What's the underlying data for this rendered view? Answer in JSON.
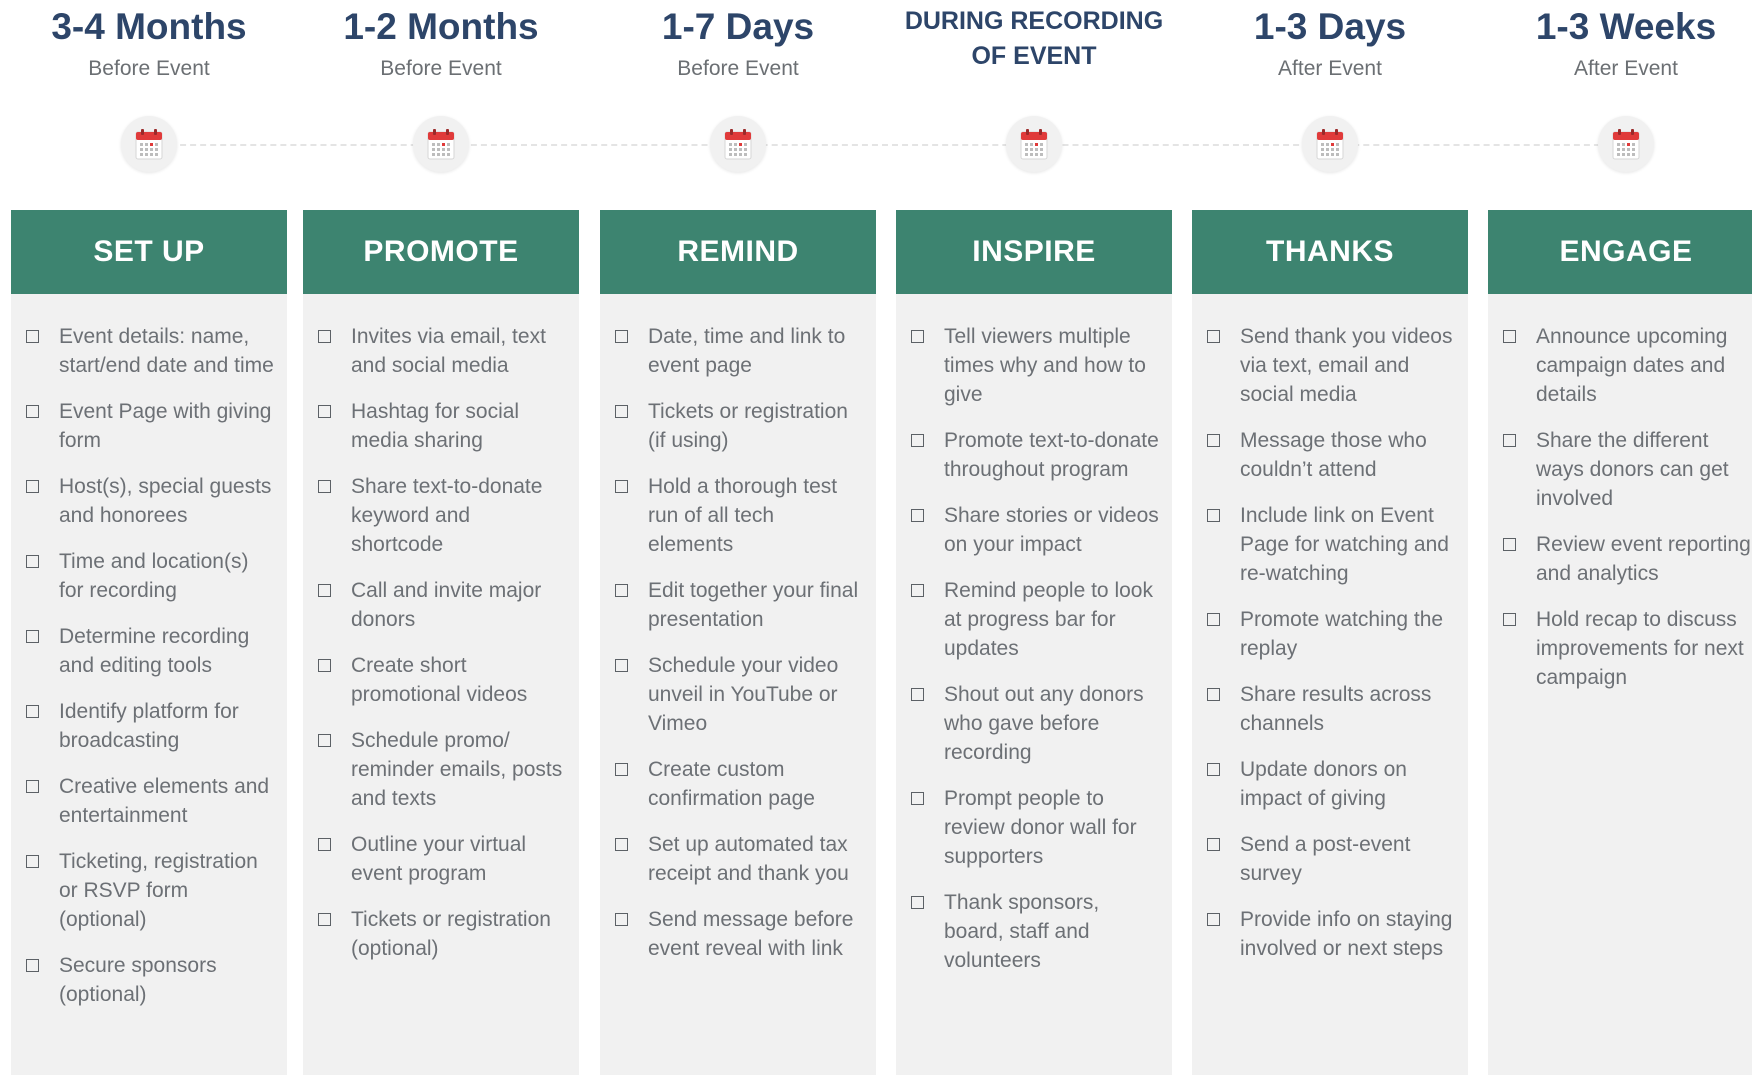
{
  "columns": [
    {
      "time": "3-4 Months",
      "subtitle": "Before Event",
      "icon": "calendar-icon",
      "header": "SET UP",
      "items": [
        "Event details: name, start/end date and time",
        "Event Page with giving form",
        "Host(s), special guests and honorees",
        "Time and location(s) for recording",
        "Determine recording and editing tools",
        "Identify platform for broadcasting",
        "Creative elements and entertainment",
        "Ticketing, registration or RSVP form (optional)",
        "Secure sponsors (optional)"
      ]
    },
    {
      "time": "1-2 Months",
      "subtitle": "Before Event",
      "icon": "calendar-icon",
      "header": "PROMOTE",
      "items": [
        "Invites via email, text and social media",
        "Hashtag for social media sharing",
        "Share text-to-donate keyword and shortcode",
        "Call and invite major donors",
        "Create short promotional videos",
        "Schedule promo/ reminder emails, posts and texts",
        "Outline your virtual event program",
        "Tickets or registration (optional)"
      ]
    },
    {
      "time": "1-7 Days",
      "subtitle": "Before Event",
      "icon": "calendar-icon",
      "header": "REMIND",
      "items": [
        "Date, time and link to event page",
        "Tickets or registration (if using)",
        "Hold a thorough test run of all tech elements",
        "Edit together your final presentation",
        "Schedule your video unveil in YouTube or Vimeo",
        "Create custom confirmation page",
        "Set up automated tax receipt and thank you",
        "Send message before event reveal with link"
      ]
    },
    {
      "time": "DURING RECORDING OF EVENT",
      "subtitle": "",
      "icon": "calendar-icon",
      "header": "INSPIRE",
      "items": [
        "Tell viewers multiple times why and how to give",
        "Promote text-to-donate throughout program",
        "Share stories or videos on your impact",
        "Remind people to look at progress bar for updates",
        "Shout out any donors who gave before recording",
        "Prompt people to review donor wall for supporters",
        "Thank sponsors, board, staff and volunteers"
      ]
    },
    {
      "time": "1-3 Days",
      "subtitle": "After Event",
      "icon": "calendar-icon",
      "header": "THANKS",
      "items": [
        "Send thank you videos via text, email and social media",
        "Message those who couldn’t attend",
        "Include link on Event Page for watching and re-watching",
        "Promote watching the replay",
        "Share results across channels",
        "Update donors on impact of giving",
        "Send a post-event survey",
        "Provide info on staying involved or next steps"
      ]
    },
    {
      "time": "1-3 Weeks",
      "subtitle": "After Event",
      "icon": "calendar-icon",
      "header": "ENGAGE",
      "items": [
        "Announce upcoming campaign dates and details",
        "Share the different ways donors can get involved",
        "Review event reporting and analytics",
        "Hold recap to discuss improvements for next campaign"
      ]
    }
  ],
  "colors": {
    "header_green": "#3d8470",
    "title_navy": "#2d4569",
    "card_bg": "#f1f1f1",
    "calendar_red": "#e03a3a"
  }
}
